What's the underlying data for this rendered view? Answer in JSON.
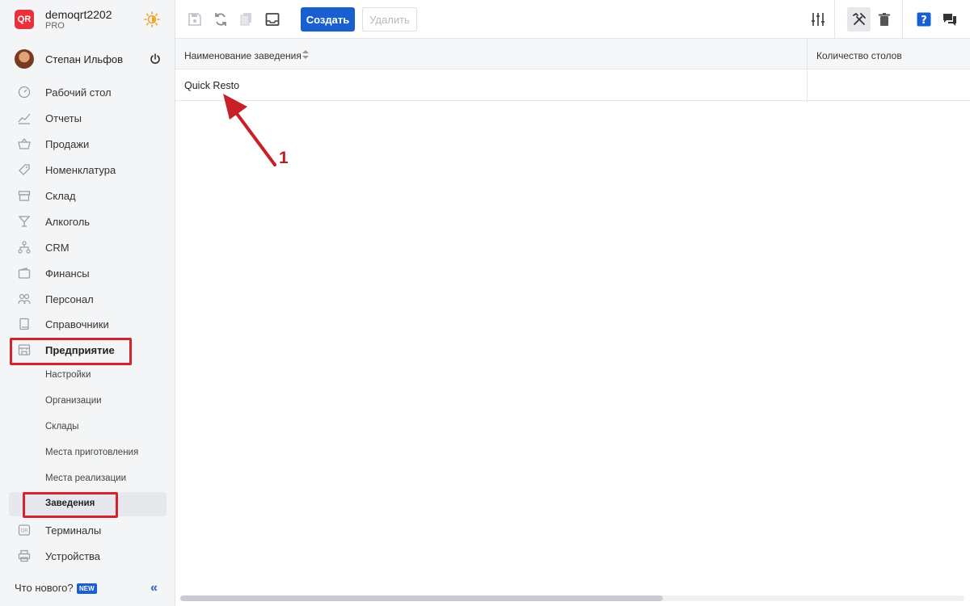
{
  "account": {
    "name": "demoqrt2202",
    "plan": "PRO",
    "logo_text": "QR"
  },
  "user": {
    "name": "Степан Ильфов"
  },
  "sidebar": {
    "items": [
      {
        "label": "Рабочий стол",
        "icon": "dashboard-icon"
      },
      {
        "label": "Отчеты",
        "icon": "chart-icon"
      },
      {
        "label": "Продажи",
        "icon": "basket-icon"
      },
      {
        "label": "Номенклатура",
        "icon": "tag-icon"
      },
      {
        "label": "Склад",
        "icon": "box-icon"
      },
      {
        "label": "Алкоголь",
        "icon": "cocktail-icon"
      },
      {
        "label": "CRM",
        "icon": "people-tree-icon"
      },
      {
        "label": "Финансы",
        "icon": "wallet-icon"
      },
      {
        "label": "Персонал",
        "icon": "staff-icon"
      },
      {
        "label": "Справочники",
        "icon": "book-icon"
      },
      {
        "label": "Предприятие",
        "icon": "store-icon"
      }
    ],
    "subitems": [
      {
        "label": "Настройки"
      },
      {
        "label": "Организации"
      },
      {
        "label": "Склады"
      },
      {
        "label": "Места приготовления"
      },
      {
        "label": "Места реализации"
      },
      {
        "label": "Заведения"
      }
    ],
    "bottom_items": [
      {
        "label": "Терминалы",
        "icon": "terminal-icon"
      },
      {
        "label": "Устройства",
        "icon": "printer-icon"
      }
    ],
    "whats_new": "Что нового?",
    "new_badge": "NEW",
    "collapse": "«"
  },
  "toolbar": {
    "create_label": "Создать",
    "delete_label": "Удалить"
  },
  "grid": {
    "columns": [
      "Наименование заведения",
      "Количество столов"
    ],
    "rows": [
      {
        "name": "Quick Resto",
        "tables": ""
      }
    ]
  },
  "annotation": {
    "number": "1"
  },
  "colors": {
    "accent": "#1a5fcf",
    "highlight": "#d4232b"
  }
}
